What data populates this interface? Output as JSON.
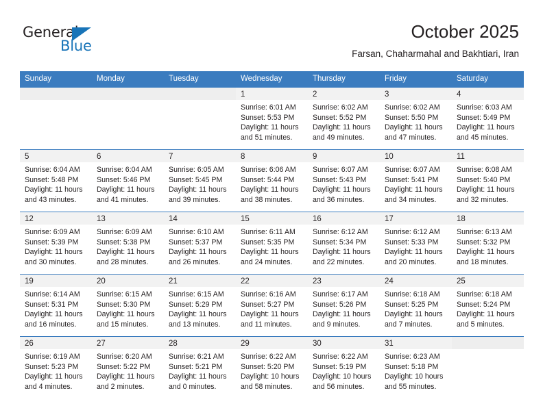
{
  "brand": {
    "name_part1": "General",
    "name_part2": "Blue",
    "triangle_color": "#1874b8",
    "text_color": "#231f20"
  },
  "header": {
    "title": "October 2025",
    "subtitle": "Farsan, Chaharmahal and Bakhtiari, Iran"
  },
  "theme": {
    "header_blue": "#3b7cbf",
    "number_band": "#f2f2f2",
    "empty_band": "#eeeeee",
    "text": "#231f20"
  },
  "calendar": {
    "weekday_headers": [
      "Sunday",
      "Monday",
      "Tuesday",
      "Wednesday",
      "Thursday",
      "Friday",
      "Saturday"
    ],
    "weeks": [
      [
        {
          "num": "",
          "sunrise": "",
          "sunset": "",
          "daylight1": "",
          "daylight2": ""
        },
        {
          "num": "",
          "sunrise": "",
          "sunset": "",
          "daylight1": "",
          "daylight2": ""
        },
        {
          "num": "",
          "sunrise": "",
          "sunset": "",
          "daylight1": "",
          "daylight2": ""
        },
        {
          "num": "1",
          "sunrise": "Sunrise: 6:01 AM",
          "sunset": "Sunset: 5:53 PM",
          "daylight1": "Daylight: 11 hours",
          "daylight2": "and 51 minutes."
        },
        {
          "num": "2",
          "sunrise": "Sunrise: 6:02 AM",
          "sunset": "Sunset: 5:52 PM",
          "daylight1": "Daylight: 11 hours",
          "daylight2": "and 49 minutes."
        },
        {
          "num": "3",
          "sunrise": "Sunrise: 6:02 AM",
          "sunset": "Sunset: 5:50 PM",
          "daylight1": "Daylight: 11 hours",
          "daylight2": "and 47 minutes."
        },
        {
          "num": "4",
          "sunrise": "Sunrise: 6:03 AM",
          "sunset": "Sunset: 5:49 PM",
          "daylight1": "Daylight: 11 hours",
          "daylight2": "and 45 minutes."
        }
      ],
      [
        {
          "num": "5",
          "sunrise": "Sunrise: 6:04 AM",
          "sunset": "Sunset: 5:48 PM",
          "daylight1": "Daylight: 11 hours",
          "daylight2": "and 43 minutes."
        },
        {
          "num": "6",
          "sunrise": "Sunrise: 6:04 AM",
          "sunset": "Sunset: 5:46 PM",
          "daylight1": "Daylight: 11 hours",
          "daylight2": "and 41 minutes."
        },
        {
          "num": "7",
          "sunrise": "Sunrise: 6:05 AM",
          "sunset": "Sunset: 5:45 PM",
          "daylight1": "Daylight: 11 hours",
          "daylight2": "and 39 minutes."
        },
        {
          "num": "8",
          "sunrise": "Sunrise: 6:06 AM",
          "sunset": "Sunset: 5:44 PM",
          "daylight1": "Daylight: 11 hours",
          "daylight2": "and 38 minutes."
        },
        {
          "num": "9",
          "sunrise": "Sunrise: 6:07 AM",
          "sunset": "Sunset: 5:43 PM",
          "daylight1": "Daylight: 11 hours",
          "daylight2": "and 36 minutes."
        },
        {
          "num": "10",
          "sunrise": "Sunrise: 6:07 AM",
          "sunset": "Sunset: 5:41 PM",
          "daylight1": "Daylight: 11 hours",
          "daylight2": "and 34 minutes."
        },
        {
          "num": "11",
          "sunrise": "Sunrise: 6:08 AM",
          "sunset": "Sunset: 5:40 PM",
          "daylight1": "Daylight: 11 hours",
          "daylight2": "and 32 minutes."
        }
      ],
      [
        {
          "num": "12",
          "sunrise": "Sunrise: 6:09 AM",
          "sunset": "Sunset: 5:39 PM",
          "daylight1": "Daylight: 11 hours",
          "daylight2": "and 30 minutes."
        },
        {
          "num": "13",
          "sunrise": "Sunrise: 6:09 AM",
          "sunset": "Sunset: 5:38 PM",
          "daylight1": "Daylight: 11 hours",
          "daylight2": "and 28 minutes."
        },
        {
          "num": "14",
          "sunrise": "Sunrise: 6:10 AM",
          "sunset": "Sunset: 5:37 PM",
          "daylight1": "Daylight: 11 hours",
          "daylight2": "and 26 minutes."
        },
        {
          "num": "15",
          "sunrise": "Sunrise: 6:11 AM",
          "sunset": "Sunset: 5:35 PM",
          "daylight1": "Daylight: 11 hours",
          "daylight2": "and 24 minutes."
        },
        {
          "num": "16",
          "sunrise": "Sunrise: 6:12 AM",
          "sunset": "Sunset: 5:34 PM",
          "daylight1": "Daylight: 11 hours",
          "daylight2": "and 22 minutes."
        },
        {
          "num": "17",
          "sunrise": "Sunrise: 6:12 AM",
          "sunset": "Sunset: 5:33 PM",
          "daylight1": "Daylight: 11 hours",
          "daylight2": "and 20 minutes."
        },
        {
          "num": "18",
          "sunrise": "Sunrise: 6:13 AM",
          "sunset": "Sunset: 5:32 PM",
          "daylight1": "Daylight: 11 hours",
          "daylight2": "and 18 minutes."
        }
      ],
      [
        {
          "num": "19",
          "sunrise": "Sunrise: 6:14 AM",
          "sunset": "Sunset: 5:31 PM",
          "daylight1": "Daylight: 11 hours",
          "daylight2": "and 16 minutes."
        },
        {
          "num": "20",
          "sunrise": "Sunrise: 6:15 AM",
          "sunset": "Sunset: 5:30 PM",
          "daylight1": "Daylight: 11 hours",
          "daylight2": "and 15 minutes."
        },
        {
          "num": "21",
          "sunrise": "Sunrise: 6:15 AM",
          "sunset": "Sunset: 5:29 PM",
          "daylight1": "Daylight: 11 hours",
          "daylight2": "and 13 minutes."
        },
        {
          "num": "22",
          "sunrise": "Sunrise: 6:16 AM",
          "sunset": "Sunset: 5:27 PM",
          "daylight1": "Daylight: 11 hours",
          "daylight2": "and 11 minutes."
        },
        {
          "num": "23",
          "sunrise": "Sunrise: 6:17 AM",
          "sunset": "Sunset: 5:26 PM",
          "daylight1": "Daylight: 11 hours",
          "daylight2": "and 9 minutes."
        },
        {
          "num": "24",
          "sunrise": "Sunrise: 6:18 AM",
          "sunset": "Sunset: 5:25 PM",
          "daylight1": "Daylight: 11 hours",
          "daylight2": "and 7 minutes."
        },
        {
          "num": "25",
          "sunrise": "Sunrise: 6:18 AM",
          "sunset": "Sunset: 5:24 PM",
          "daylight1": "Daylight: 11 hours",
          "daylight2": "and 5 minutes."
        }
      ],
      [
        {
          "num": "26",
          "sunrise": "Sunrise: 6:19 AM",
          "sunset": "Sunset: 5:23 PM",
          "daylight1": "Daylight: 11 hours",
          "daylight2": "and 4 minutes."
        },
        {
          "num": "27",
          "sunrise": "Sunrise: 6:20 AM",
          "sunset": "Sunset: 5:22 PM",
          "daylight1": "Daylight: 11 hours",
          "daylight2": "and 2 minutes."
        },
        {
          "num": "28",
          "sunrise": "Sunrise: 6:21 AM",
          "sunset": "Sunset: 5:21 PM",
          "daylight1": "Daylight: 11 hours",
          "daylight2": "and 0 minutes."
        },
        {
          "num": "29",
          "sunrise": "Sunrise: 6:22 AM",
          "sunset": "Sunset: 5:20 PM",
          "daylight1": "Daylight: 10 hours",
          "daylight2": "and 58 minutes."
        },
        {
          "num": "30",
          "sunrise": "Sunrise: 6:22 AM",
          "sunset": "Sunset: 5:19 PM",
          "daylight1": "Daylight: 10 hours",
          "daylight2": "and 56 minutes."
        },
        {
          "num": "31",
          "sunrise": "Sunrise: 6:23 AM",
          "sunset": "Sunset: 5:18 PM",
          "daylight1": "Daylight: 10 hours",
          "daylight2": "and 55 minutes."
        },
        {
          "num": "",
          "sunrise": "",
          "sunset": "",
          "daylight1": "",
          "daylight2": ""
        }
      ]
    ]
  }
}
